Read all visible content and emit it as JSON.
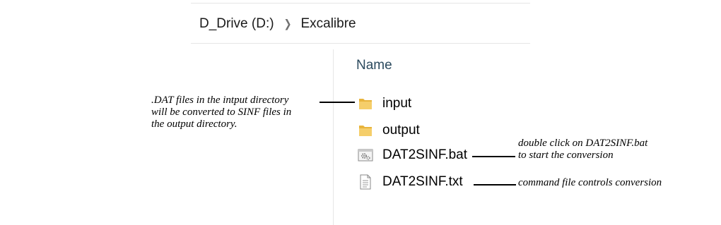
{
  "breadcrumb": {
    "items": [
      "D_Drive (D:)",
      "Excalibre"
    ],
    "separator_icon": "chevron-right-icon"
  },
  "file_list": {
    "column_header": "Name",
    "items": [
      {
        "name": "input",
        "icon": "folder-icon"
      },
      {
        "name": "output",
        "icon": "folder-icon"
      },
      {
        "name": "DAT2SINF.bat",
        "icon": "batch-file-icon"
      },
      {
        "name": "DAT2SINF.txt",
        "icon": "text-file-icon"
      }
    ]
  },
  "annotations": {
    "input_note": [
      ".DAT files in the intput directory",
      "will be converted to SINF files in",
      "the output directory."
    ],
    "bat_note": [
      "double click on DAT2SINF.bat",
      "to start the conversion"
    ],
    "txt_note": [
      "command file controls conversion"
    ]
  },
  "colors": {
    "folder": "#f2c55c",
    "header_text": "#2b4a5e",
    "divider": "#e6e6e6"
  }
}
